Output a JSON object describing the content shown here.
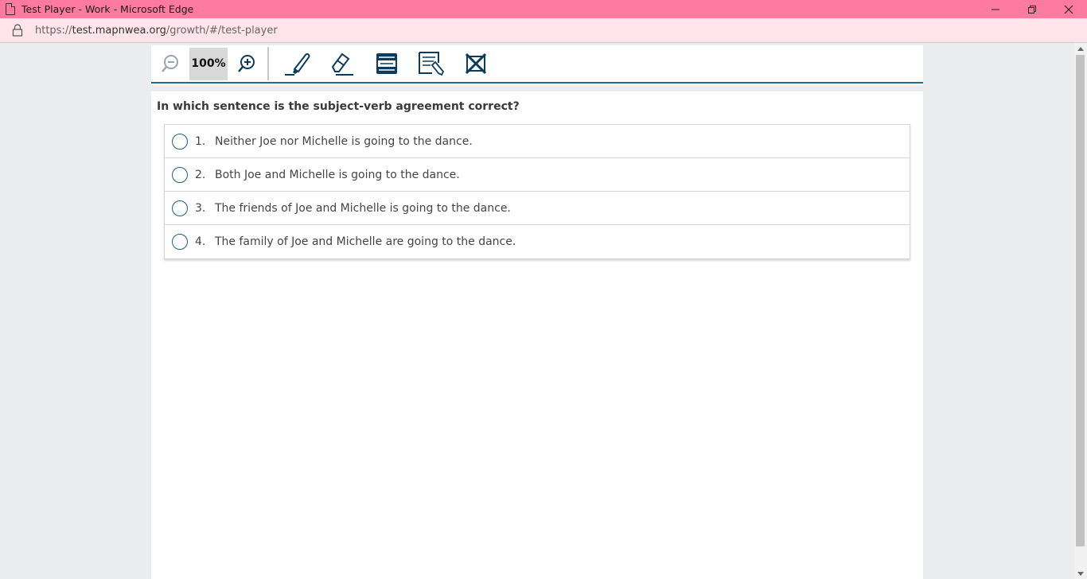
{
  "window": {
    "title": "Test Player - Work - Microsoft Edge"
  },
  "address": {
    "url_prefix": "https://",
    "url_host": "test.mapnwea.org",
    "url_path": "/growth/#/test-player"
  },
  "toolbar": {
    "zoom_level": "100%",
    "tools": [
      "zoom-out-icon",
      "zoom-in-icon",
      "highlighter-icon",
      "eraser-icon",
      "line-guide-icon",
      "notepad-icon",
      "answer-eliminator-icon"
    ]
  },
  "question": {
    "prompt": "In which sentence is the subject-verb agreement correct?",
    "choices": [
      {
        "num": "1.",
        "text": "Neither Joe nor Michelle is going to the dance."
      },
      {
        "num": "2.",
        "text": "Both Joe and Michelle is going to the dance."
      },
      {
        "num": "3.",
        "text": "The friends of Joe and Michelle is going to the dance."
      },
      {
        "num": "4.",
        "text": "The family of Joe and Michelle are going to the dance."
      }
    ]
  },
  "colors": {
    "titlebar": "#ff7aa0",
    "addressbar": "#ffe4eb",
    "accent": "#1e6f8e",
    "icon": "#0d3b5e"
  }
}
